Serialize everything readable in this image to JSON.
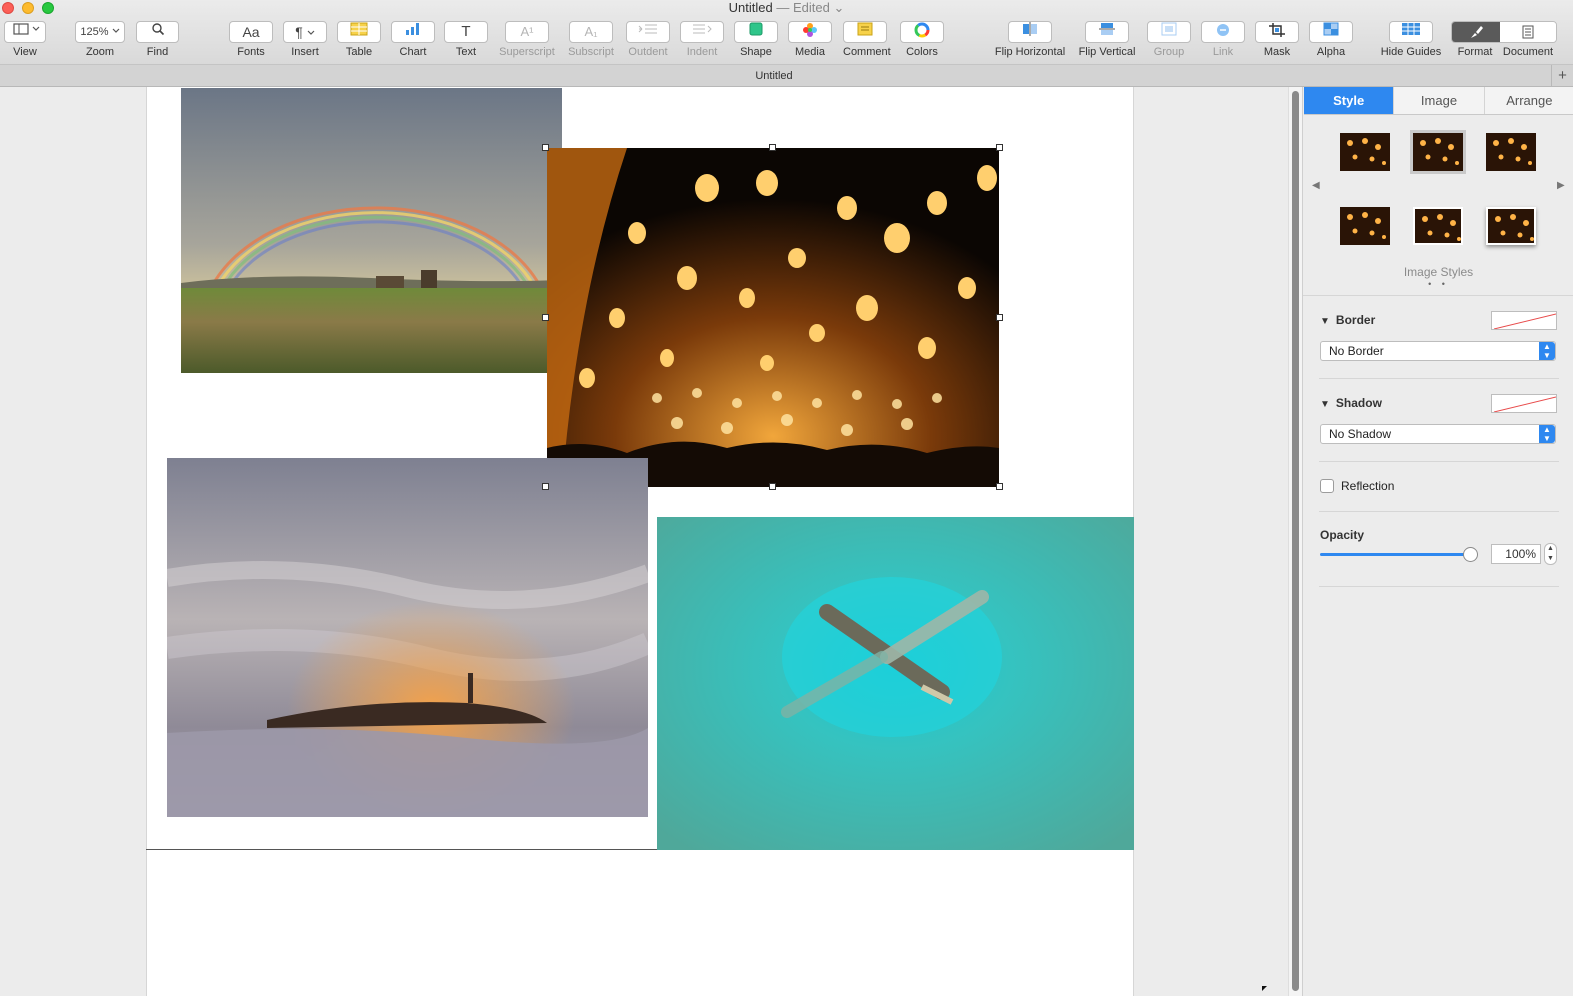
{
  "window": {
    "title": "Untitled",
    "edited": "— Edited",
    "dropdown_glyph": "⌄"
  },
  "toolbar": {
    "view": {
      "label": "View",
      "icon": "sidebar-icon"
    },
    "zoom": {
      "label": "Zoom",
      "value": "125%"
    },
    "find": {
      "label": "Find",
      "icon": "magnifier-icon"
    },
    "fonts": {
      "label": "Fonts",
      "glyph": "Aa"
    },
    "insert": {
      "label": "Insert",
      "glyph": "¶"
    },
    "table": {
      "label": "Table"
    },
    "chart": {
      "label": "Chart"
    },
    "text": {
      "label": "Text",
      "glyph": "T"
    },
    "superscript": {
      "label": "Superscript",
      "glyph": "A¹"
    },
    "subscript": {
      "label": "Subscript",
      "glyph": "A₁"
    },
    "outdent": {
      "label": "Outdent"
    },
    "indent": {
      "label": "Indent"
    },
    "shape": {
      "label": "Shape"
    },
    "media": {
      "label": "Media"
    },
    "comment": {
      "label": "Comment"
    },
    "colors": {
      "label": "Colors"
    },
    "flip_horizontal": {
      "label": "Flip Horizontal"
    },
    "flip_vertical": {
      "label": "Flip Vertical"
    },
    "group": {
      "label": "Group"
    },
    "link": {
      "label": "Link"
    },
    "mask": {
      "label": "Mask"
    },
    "alpha": {
      "label": "Alpha"
    },
    "hide_guides": {
      "label": "Hide Guides"
    },
    "format": {
      "label": "Format"
    },
    "document": {
      "label": "Document"
    }
  },
  "tabbar": {
    "title": "Untitled",
    "add_glyph": "+"
  },
  "inspector": {
    "tabs": [
      {
        "label": "Style"
      },
      {
        "label": "Image"
      },
      {
        "label": "Arrange"
      }
    ],
    "image_styles_caption": "Image Styles",
    "pager_dots": "• •",
    "prev_arrow": "◀",
    "next_arrow": "▶",
    "border": {
      "title": "Border",
      "value": "No Border"
    },
    "shadow": {
      "title": "Shadow",
      "value": "No Shadow"
    },
    "reflection": {
      "label": "Reflection",
      "checked": false
    },
    "opacity": {
      "title": "Opacity",
      "value": "100%",
      "level": 1.0
    }
  },
  "colors": {
    "accent": "#2e88f0"
  }
}
